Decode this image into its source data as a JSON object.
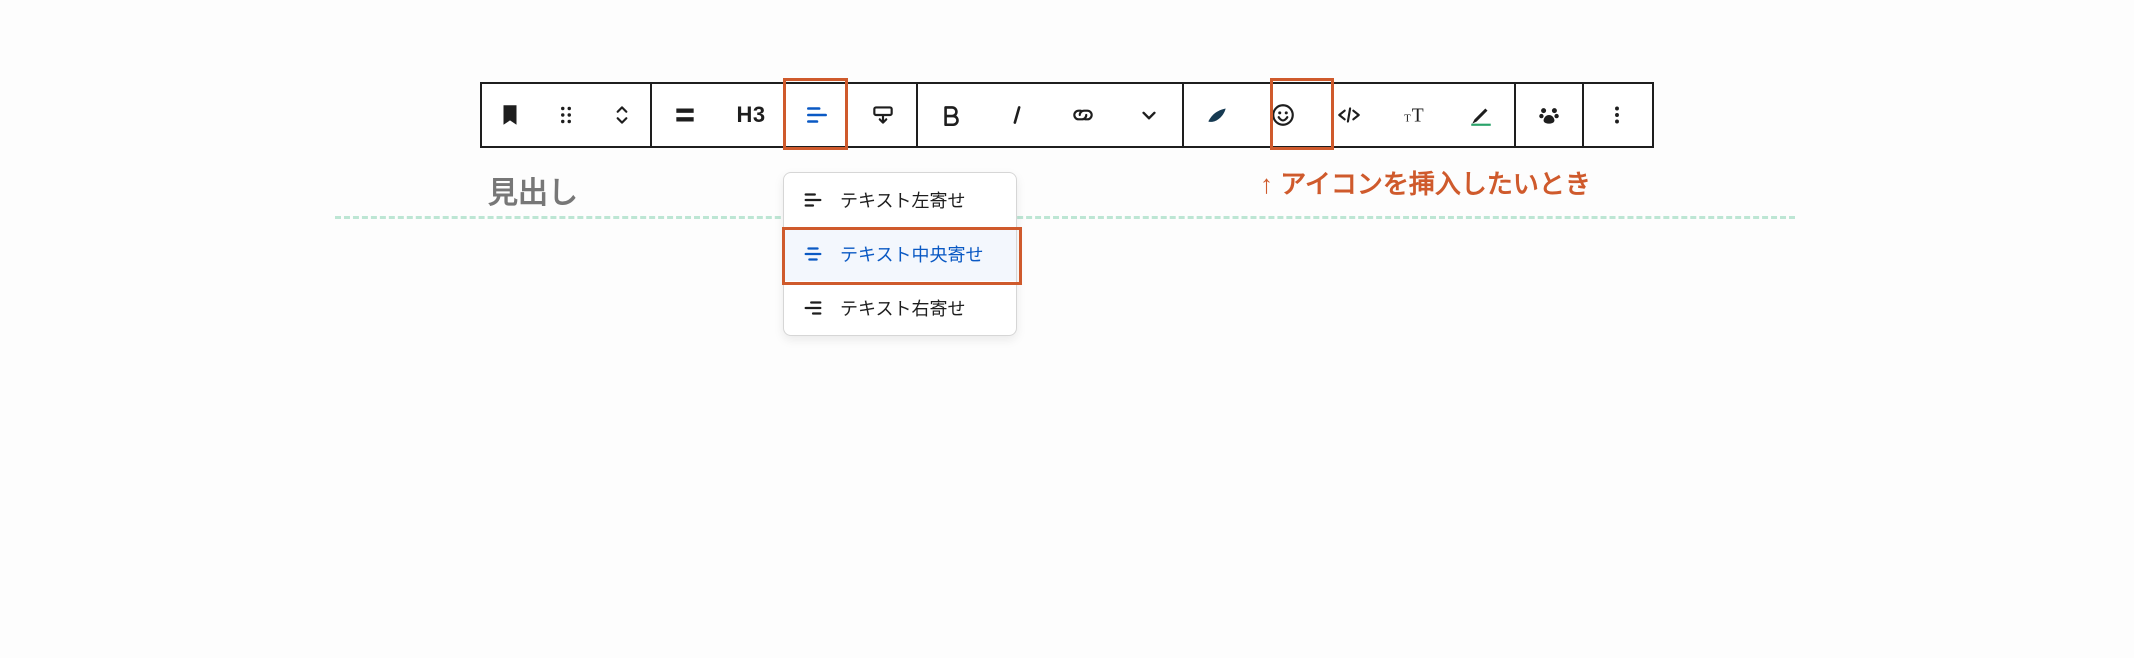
{
  "toolbar": {
    "heading_level": "H3"
  },
  "dropdown": {
    "items": [
      {
        "label": "テキスト左寄せ"
      },
      {
        "label": "テキスト中央寄せ"
      },
      {
        "label": "テキスト右寄せ"
      }
    ]
  },
  "heading_placeholder": "見出し",
  "annotation": "↑ アイコンを挿入したいとき"
}
